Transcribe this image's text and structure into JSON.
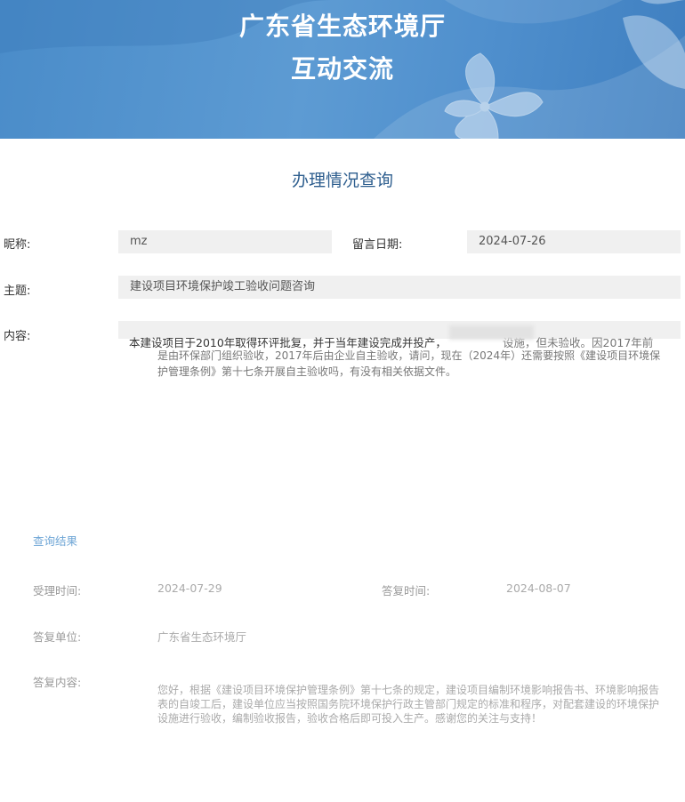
{
  "banner": {
    "title_line1": "广东省生态环境厅",
    "title_line2": "互动交流"
  },
  "section_title": "办理情况查询",
  "message": {
    "nickname_label": "昵称:",
    "nickname_value": "mz",
    "date_label": "留言日期:",
    "date_value": "2024-07-26",
    "subject_label": "主题:",
    "subject_value": "建设项目环境保护竣工验收问题咨询",
    "content_label": "内容:",
    "content_line1": "本建设项目于2010年取得环评批复，并于当年建设完成并投产，",
    "content_line2": "是由环保部门组织验收，2017年后由企业自主验收，请问，现在（2024年）还需要按照《建设项目环境保",
    "content_line3": "护管理条例》第十七条开展自主验收吗，有没有相关依据文件。",
    "content_line1_tail": "设施，但未验收。因2017年前"
  },
  "result": {
    "query_result_link": "查询结果",
    "accept_time_label": "受理时间:",
    "accept_time_value": "2024-07-29",
    "reply_time_label": "答复时间:",
    "reply_time_value": "2024-08-07",
    "reply_unit_label": "答复单位:",
    "reply_unit_value": "广东省生态环境厅",
    "reply_content_label": "答复内容:",
    "reply_line1": "您好，根据《建设项目环境保护管理条例》第十七条的规定，建设项目编制环境影响报告书、环境影响报告",
    "reply_line2": "表的自竣工后，建设单位应当按照国务院环境保护行政主管部门规定的标准和程序，对配套建设的环境保护",
    "reply_line3": "设施进行验收，编制验收报告，验收合格后即可投入生产。感谢您的关注与支持！"
  }
}
